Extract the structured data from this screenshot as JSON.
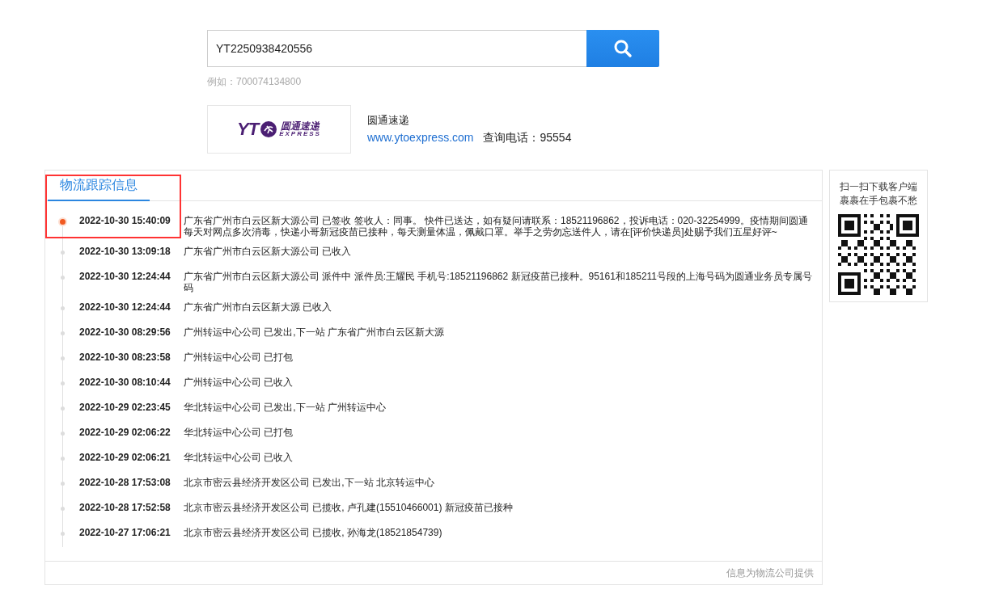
{
  "search": {
    "value": "YT2250938420556",
    "hint": "例如：700074134800"
  },
  "carrier": {
    "logo": {
      "mark": "YT",
      "name": "圆通速递",
      "sub": "EXPRESS"
    },
    "name": "圆通速递",
    "website": "www.ytoexpress.com",
    "phone": "查询电话：95554"
  },
  "tracking": {
    "tab": "物流跟踪信息",
    "entries": [
      {
        "time": "2022-10-30 15:40:09",
        "text": "广东省广州市白云区新大源公司 已签收 签收人：同事。 快件已送达，如有疑问请联系：18521196862，投诉电话：020-32254999。疫情期间圆通每天对网点多次消毒，快递小哥新冠疫苗已接种，每天测量体温，佩戴口罩。举手之劳勿忘送件人，请在[评价快递员]处赐予我们五星好评~",
        "current": true
      },
      {
        "time": "2022-10-30 13:09:18",
        "text": "广东省广州市白云区新大源公司 已收入",
        "current": false
      },
      {
        "time": "2022-10-30 12:24:44",
        "text": "广东省广州市白云区新大源公司 派件中 派件员:王耀民 手机号:18521196862 新冠疫苗已接种。95161和185211号段的上海号码为圆通业务员专属号码",
        "current": false
      },
      {
        "time": "2022-10-30 12:24:44",
        "text": "广东省广州市白云区新大源 已收入",
        "current": false
      },
      {
        "time": "2022-10-30 08:29:56",
        "text": "广州转运中心公司 已发出,下一站 广东省广州市白云区新大源",
        "current": false
      },
      {
        "time": "2022-10-30 08:23:58",
        "text": "广州转运中心公司 已打包",
        "current": false
      },
      {
        "time": "2022-10-30 08:10:44",
        "text": "广州转运中心公司 已收入",
        "current": false
      },
      {
        "time": "2022-10-29 02:23:45",
        "text": "华北转运中心公司 已发出,下一站 广州转运中心",
        "current": false
      },
      {
        "time": "2022-10-29 02:06:22",
        "text": "华北转运中心公司 已打包",
        "current": false
      },
      {
        "time": "2022-10-29 02:06:21",
        "text": "华北转运中心公司 已收入",
        "current": false
      },
      {
        "time": "2022-10-28 17:53:08",
        "text": "北京市密云县经济开发区公司 已发出,下一站 北京转运中心",
        "current": false
      },
      {
        "time": "2022-10-28 17:52:58",
        "text": "北京市密云县经济开发区公司 已揽收, 卢孔建(15510466001) 新冠疫苗已接种",
        "current": false
      },
      {
        "time": "2022-10-27 17:06:21",
        "text": "北京市密云县经济开发区公司 已揽收, 孙海龙(18521854739)",
        "current": false
      }
    ],
    "footer": "信息为物流公司提供"
  },
  "qr": {
    "caption": [
      "扫一扫下载客户端",
      "裹裹在手包裹不愁"
    ]
  }
}
